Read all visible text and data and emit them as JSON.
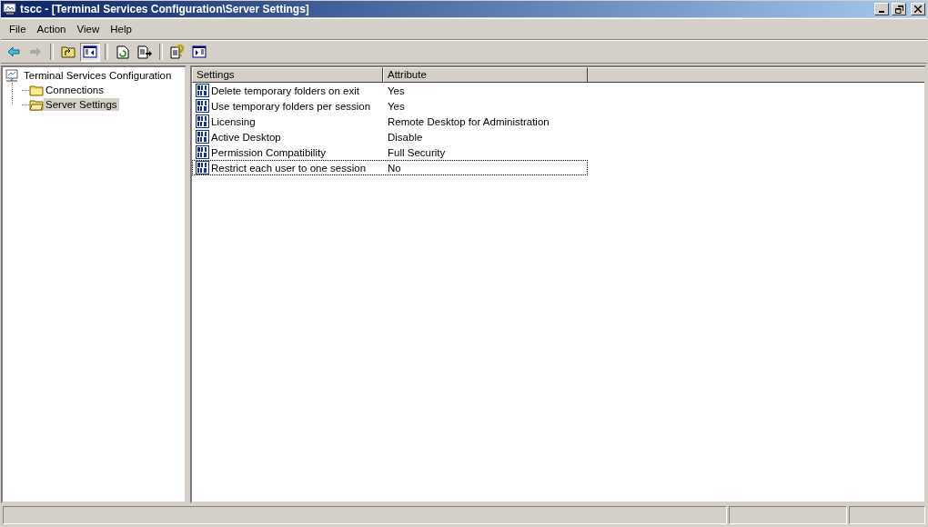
{
  "window": {
    "title": "tscc - [Terminal Services Configuration\\Server Settings]"
  },
  "menu": [
    "File",
    "Action",
    "View",
    "Help"
  ],
  "toolbar": [
    {
      "kind": "back",
      "disabled": false,
      "pressed": false
    },
    {
      "kind": "forward",
      "disabled": true,
      "pressed": false
    },
    {
      "kind": "sep"
    },
    {
      "kind": "up",
      "disabled": false,
      "pressed": false
    },
    {
      "kind": "tree",
      "disabled": false,
      "pressed": true
    },
    {
      "kind": "sep"
    },
    {
      "kind": "refresh",
      "disabled": false,
      "pressed": false
    },
    {
      "kind": "export",
      "disabled": false,
      "pressed": false
    },
    {
      "kind": "sep"
    },
    {
      "kind": "help",
      "disabled": false,
      "pressed": false
    },
    {
      "kind": "pane",
      "disabled": false,
      "pressed": false
    }
  ],
  "tree": {
    "label": "Terminal Services Configuration",
    "selected": false,
    "children": [
      {
        "label": "Connections",
        "selected": false
      },
      {
        "label": "Server Settings",
        "selected": true
      }
    ]
  },
  "table": {
    "columns": [
      "Settings",
      "Attribute"
    ],
    "rows": [
      {
        "setting": "Delete temporary folders on exit",
        "attribute": "Yes",
        "focused": false
      },
      {
        "setting": "Use temporary folders per session",
        "attribute": "Yes",
        "focused": false
      },
      {
        "setting": "Licensing",
        "attribute": "Remote Desktop for Administration",
        "focused": false
      },
      {
        "setting": "Active Desktop",
        "attribute": "Disable",
        "focused": false
      },
      {
        "setting": "Permission Compatibility",
        "attribute": "Full Security",
        "focused": false
      },
      {
        "setting": "Restrict each user to one session",
        "attribute": "No",
        "focused": true
      }
    ]
  }
}
